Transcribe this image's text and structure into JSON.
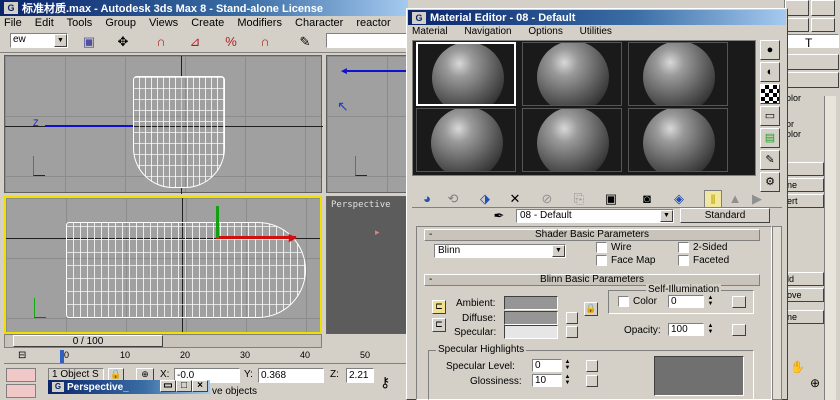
{
  "app": {
    "title": "标准材质.max - Autodesk 3ds Max 8  - Stand-alone License",
    "menus": [
      "File",
      "Edit",
      "Tools",
      "Group",
      "Views",
      "Create",
      "Modifiers",
      "Character",
      "reactor"
    ],
    "view_dropdown": "ew",
    "frame_counter": "0 / 100",
    "timeline_ticks": [
      "0",
      "10",
      "20",
      "30",
      "40",
      "50"
    ],
    "status": {
      "object_selected": "1 Object S",
      "x_label": "X:",
      "x_value": "-0.0",
      "y_label": "Y:",
      "y_value": "0.368",
      "z_label": "Z:",
      "z_value": "2.21",
      "prompt": "ve objects"
    },
    "perspective_label": "Perspective"
  },
  "taskbar_stub": {
    "title": "Perspective_"
  },
  "right_panel": {
    "labels": [
      "olor",
      "or",
      "olor",
      "ne",
      "ert",
      "ld",
      "ove",
      "ne"
    ]
  },
  "material_editor": {
    "title": "Material Editor - 08 - Default",
    "menus": [
      "Material",
      "Navigation",
      "Options",
      "Utilities"
    ],
    "material_name": "08 - Default",
    "material_type": "Standard",
    "rollouts": {
      "shader_basic": "Shader Basic Parameters",
      "blinn_basic": "Blinn Basic Parameters"
    },
    "shader": {
      "selected": "Blinn",
      "wire": "Wire",
      "two_sided": "2-Sided",
      "face_map": "Face Map",
      "faceted": "Faceted"
    },
    "blinn": {
      "ambient": "Ambient:",
      "diffuse": "Diffuse:",
      "specular": "Specular:",
      "self_illum_title": "Self-Illumination",
      "color_label": "Color",
      "color_value": "0",
      "opacity_label": "Opacity:",
      "opacity_value": "100"
    },
    "specular_highlights": {
      "title": "Specular Highlights",
      "level_label": "Specular Level:",
      "level_value": "0",
      "gloss_label": "Glossiness:",
      "gloss_value": "10"
    }
  },
  "colors": {
    "title_start": "#0a246a",
    "title_end": "#a6caf0",
    "viewport_bg": "#a0a0a0",
    "active_viewport_border": "#f0e000",
    "ambient_swatch": "#969696",
    "diffuse_swatch": "#969696",
    "specular_swatch": "#e6e6e6"
  }
}
